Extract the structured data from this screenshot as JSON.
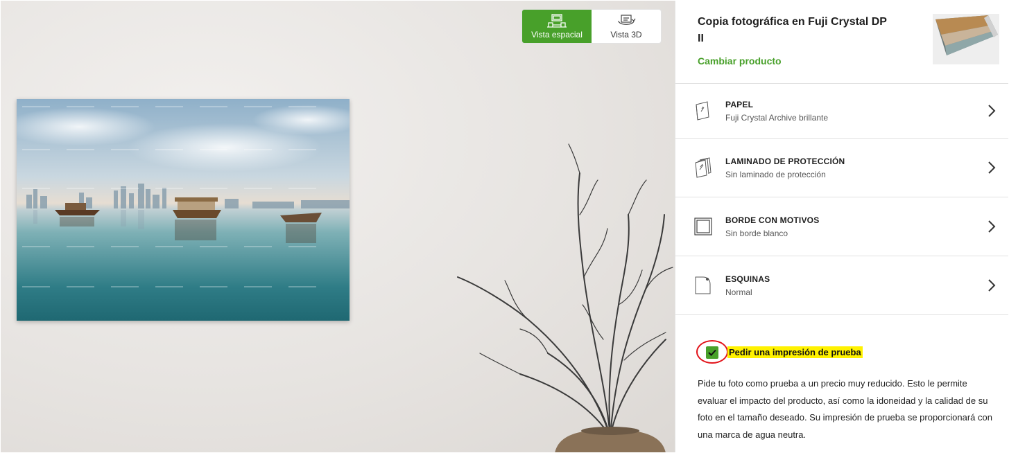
{
  "view_toggle": {
    "spatial_label": "Vista espacial",
    "view3d_label": "Vista 3D",
    "active": "spatial"
  },
  "product": {
    "title": "Copia fotográfica en Fuji Crystal DP II",
    "change_label": "Cambiar producto"
  },
  "options": [
    {
      "label": "PAPEL",
      "value": "Fuji Crystal Archive brillante",
      "icon": "paper-icon"
    },
    {
      "label": "LAMINADO DE PROTECCIÓN",
      "value": "Sin laminado de protección",
      "icon": "laminate-icon"
    },
    {
      "label": "BORDE CON MOTIVOS",
      "value": "Sin borde blanco",
      "icon": "border-icon"
    },
    {
      "label": "ESQUINAS",
      "value": "Normal",
      "icon": "corners-icon"
    }
  ],
  "test_print": {
    "checked": true,
    "label": "Pedir una impresión de prueba",
    "description": "Pide tu foto como prueba a un precio muy reducido. Esto le permite evaluar el impacto del producto, así como la idoneidad y la calidad de su foto en el tamaño deseado. Su impresión de prueba se proporcionará con una marca de agua neutra."
  },
  "colors": {
    "accent": "#48a02a",
    "highlight": "#fff200",
    "annotation_ring": "#e2141b"
  }
}
